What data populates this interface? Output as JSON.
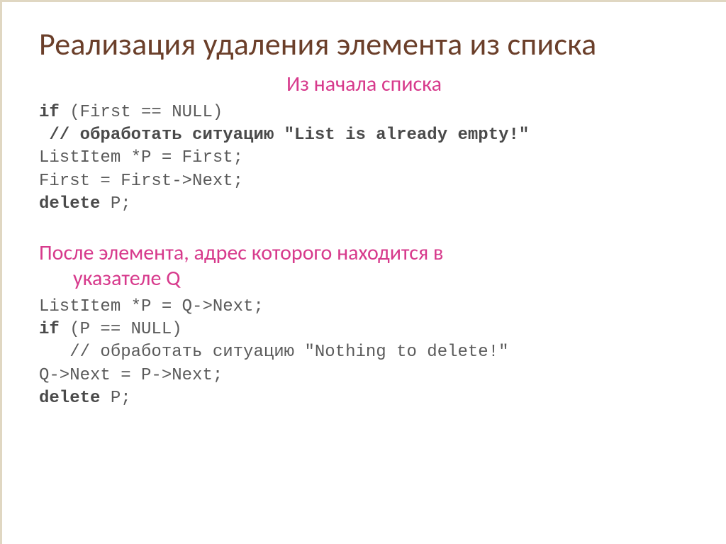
{
  "title": "Реализация удаления элемента из списка",
  "subtitle1": "Из начала списка",
  "code1": {
    "l1a": "if",
    "l1b": " (First == NULL)",
    "l2": " // обработать ситуацию ″List is already empty!″",
    "l3": "ListItem *P = First;",
    "l4": "First = First->Next;",
    "l5a": "delete",
    "l5b": " P;"
  },
  "subtitle2_line1": "После элемента, адрес которого находится в",
  "subtitle2_line2": "указателе Q",
  "code2": {
    "l1": "ListItem *P = Q->Next;",
    "l2a": "if",
    "l2b": " (P == NULL)",
    "l3": "   // обработать ситуацию ″Nothing to delete!″",
    "l4": "Q->Next = P->Next;",
    "l5a": "delete",
    "l5b": " P;"
  }
}
